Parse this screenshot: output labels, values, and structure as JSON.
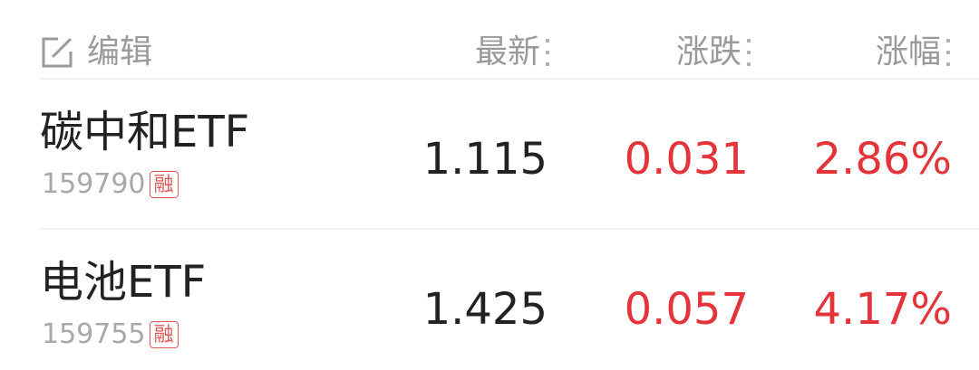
{
  "header": {
    "edit_label": "编辑",
    "columns": [
      {
        "label": "最新"
      },
      {
        "label": "涨跌"
      },
      {
        "label": "涨幅"
      }
    ]
  },
  "rows": [
    {
      "name": "碳中和ETF",
      "code": "159790",
      "badge": "融",
      "latest": "1.115",
      "change": "0.031",
      "change_pct": "2.86%"
    },
    {
      "name": "电池ETF",
      "code": "159755",
      "badge": "融",
      "latest": "1.425",
      "change": "0.057",
      "change_pct": "4.17%"
    }
  ],
  "colors": {
    "up": "#e3343a",
    "text": "#222222",
    "muted": "#9a9a9a",
    "badge": "#e05a5a"
  },
  "icons": {
    "edit": "edit-icon",
    "sort": "sort-dots-icon"
  }
}
